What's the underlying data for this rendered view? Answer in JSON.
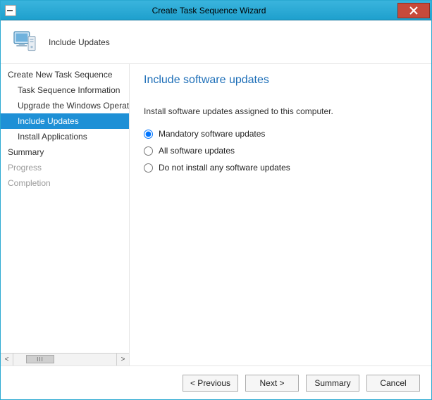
{
  "window": {
    "title": "Create Task Sequence Wizard"
  },
  "header": {
    "page_name": "Include Updates"
  },
  "nav": {
    "items": [
      {
        "label": "Create New Task Sequence",
        "level": 1,
        "state": "enabled"
      },
      {
        "label": "Task Sequence Information",
        "level": 2,
        "state": "enabled"
      },
      {
        "label": "Upgrade the Windows Operating System",
        "level": 2,
        "state": "enabled"
      },
      {
        "label": "Include Updates",
        "level": 2,
        "state": "selected"
      },
      {
        "label": "Install Applications",
        "level": 2,
        "state": "enabled"
      },
      {
        "label": "Summary",
        "level": 1,
        "state": "enabled"
      },
      {
        "label": "Progress",
        "level": 1,
        "state": "disabled"
      },
      {
        "label": "Completion",
        "level": 1,
        "state": "disabled"
      }
    ],
    "thumb_label": "III"
  },
  "content": {
    "heading": "Include software updates",
    "instruction": "Install software updates assigned to this computer.",
    "options": [
      {
        "label": "Mandatory software updates",
        "checked": true
      },
      {
        "label": "All software updates",
        "checked": false
      },
      {
        "label": "Do not install any software updates",
        "checked": false
      }
    ]
  },
  "footer": {
    "previous": "< Previous",
    "next": "Next >",
    "summary": "Summary",
    "cancel": "Cancel"
  }
}
